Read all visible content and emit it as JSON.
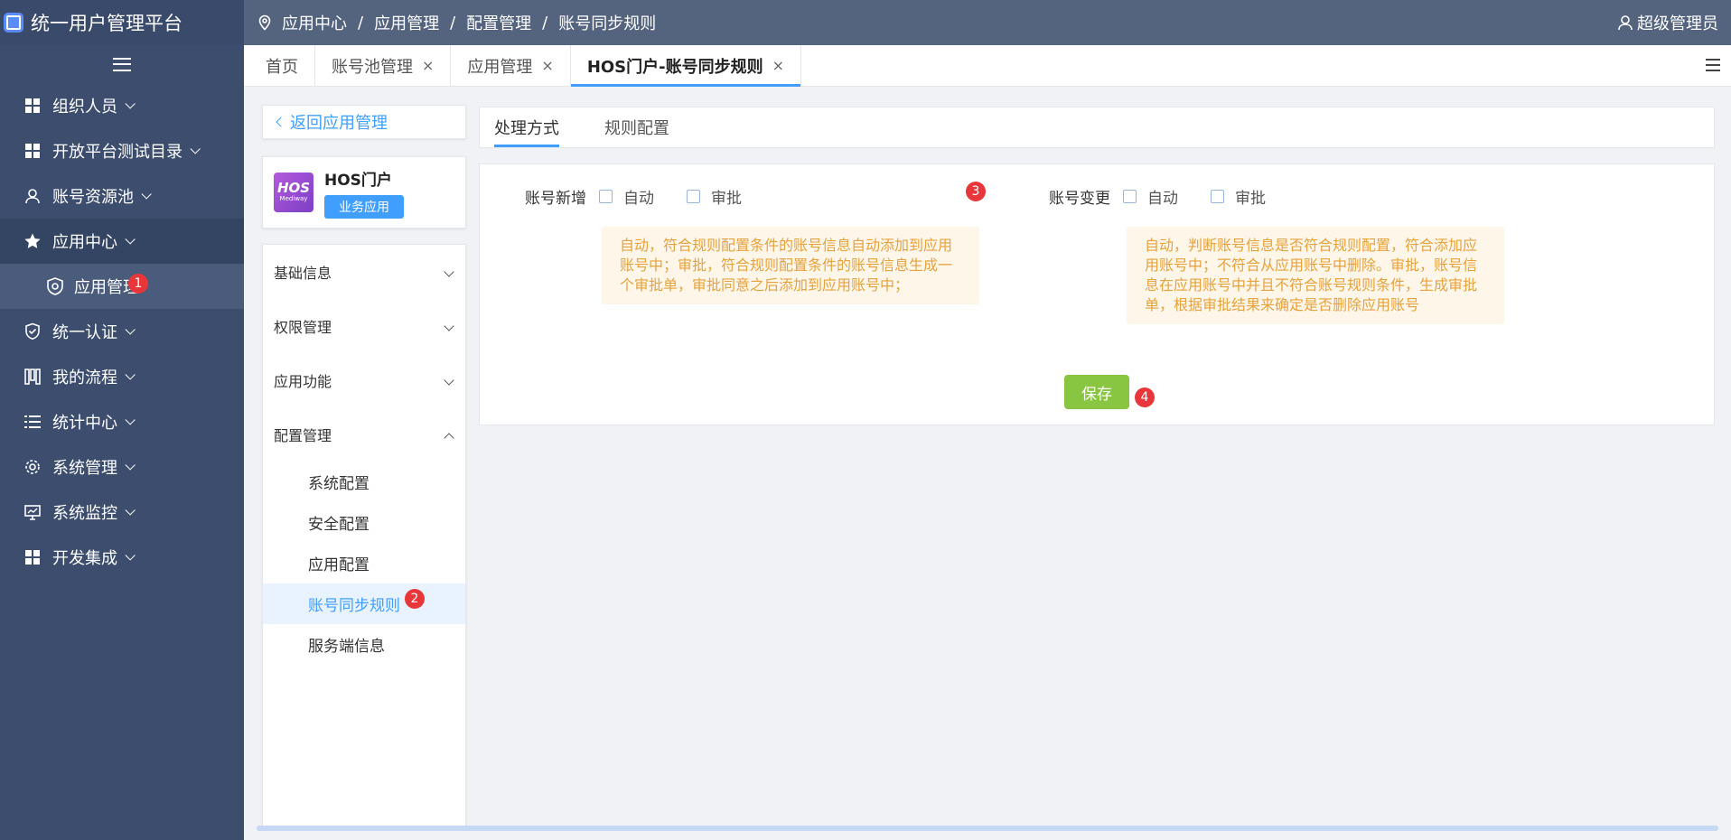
{
  "app": {
    "title": "统一用户管理平台"
  },
  "sidebar": {
    "items": [
      {
        "label": "组织人员",
        "icon": "grid-icon"
      },
      {
        "label": "开放平台测试目录",
        "icon": "grid-icon"
      },
      {
        "label": "账号资源池",
        "icon": "user-icon"
      },
      {
        "label": "应用中心",
        "icon": "star-icon"
      },
      {
        "label": "统一认证",
        "icon": "shield-icon"
      },
      {
        "label": "我的流程",
        "icon": "flow-icon"
      },
      {
        "label": "统计中心",
        "icon": "list-icon"
      },
      {
        "label": "系统管理",
        "icon": "gear-icon"
      },
      {
        "label": "系统监控",
        "icon": "monitor-icon"
      },
      {
        "label": "开发集成",
        "icon": "grid-icon"
      }
    ],
    "sub_item": {
      "label": "应用管理",
      "badge": "1",
      "icon": "app-manage-icon"
    }
  },
  "breadcrumb": {
    "items": [
      "应用中心",
      "应用管理",
      "配置管理",
      "账号同步规则"
    ],
    "separator": "/"
  },
  "user": {
    "name": "超级管理员"
  },
  "tabs": [
    {
      "label": "首页"
    },
    {
      "label": "账号池管理"
    },
    {
      "label": "应用管理"
    },
    {
      "label": "HOS门户-账号同步规则"
    }
  ],
  "tab_close": "×",
  "back": {
    "label": "返回应用管理"
  },
  "app_card": {
    "logo_text": "HOS",
    "logo_sub": "Mediway",
    "name": "HOS门户",
    "tag": "业务应用"
  },
  "nav": {
    "groups": [
      {
        "label": "基础信息"
      },
      {
        "label": "权限管理"
      },
      {
        "label": "应用功能"
      },
      {
        "label": "配置管理"
      }
    ],
    "subs": [
      {
        "label": "系统配置"
      },
      {
        "label": "安全配置"
      },
      {
        "label": "应用配置"
      },
      {
        "label": "账号同步规则",
        "badge": "2"
      },
      {
        "label": "服务端信息"
      }
    ]
  },
  "content_tabs": [
    {
      "label": "处理方式"
    },
    {
      "label": "规则配置"
    }
  ],
  "options": {
    "add": {
      "label": "账号新增",
      "auto": "自动",
      "approve": "审批",
      "note": "自动，符合规则配置条件的账号信息自动添加到应用账号中；审批，符合规则配置条件的账号信息生成一个审批单，审批同意之后添加到应用账号中；"
    },
    "change": {
      "label": "账号变更",
      "auto": "自动",
      "approve": "审批",
      "note": "自动，判断账号信息是否符合规则配置，符合添加应用账号中；不符合从应用账号中删除。审批，账号信息在应用账号中并且不符合账号规则条件，生成审批单，根据审批结果来确定是否删除应用账号"
    },
    "badge": "3"
  },
  "save": {
    "label": "保存",
    "badge": "4"
  },
  "colors": {
    "sidebar": "#3c4d6e",
    "topbar": "#54647f",
    "accent": "#409eff",
    "save": "#88c540",
    "badge": "#e8373a",
    "note_text": "#e6a23c",
    "note_bg": "#fdf6e9"
  }
}
